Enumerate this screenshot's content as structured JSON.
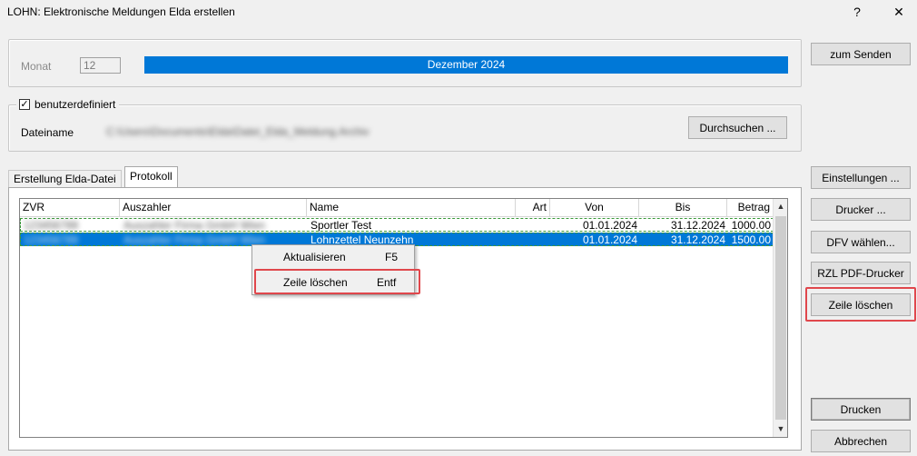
{
  "window": {
    "title": "LOHN: Elektronische Meldungen Elda erstellen",
    "help": "?",
    "close": "✕"
  },
  "top": {
    "monat_label": "Monat",
    "monat_value": "12",
    "progress_label": "Dezember  2024"
  },
  "file": {
    "checkbox_mark": "✓",
    "checkbox_label": "benutzerdefiniert",
    "dateiname_label": "Dateiname",
    "dateiname_value": "C:\\Users\\Documents\\Elda\\Datei_Elda_Meldung.Archiv",
    "browse_button": "Durchsuchen ..."
  },
  "tabs": [
    {
      "label": "Erstellung Elda-Datei",
      "active": false
    },
    {
      "label": "Protokoll",
      "active": true
    }
  ],
  "table": {
    "columns": [
      "ZVR",
      "Auszahler",
      "Name",
      "Art",
      "Von",
      "Bis",
      "Betrag"
    ],
    "rows": [
      {
        "zvr": "123456789",
        "auszahler": "Auszahler Firma GmbH Wien",
        "name": "Sportler Test",
        "art": "",
        "von": "01.01.2024",
        "bis": "31.12.2024",
        "betrag": "1000.00"
      },
      {
        "zvr": "123456789",
        "auszahler": "Auszahler Firma GmbH Wien",
        "name": "Lohnzettel Neunzehn",
        "art": "",
        "von": "01.01.2024",
        "bis": "31.12.2024",
        "betrag": "1500.00"
      }
    ]
  },
  "context_menu": [
    {
      "label": "Aktualisieren",
      "shortcut": "F5"
    },
    {
      "label": "Zeile löschen",
      "shortcut": "Entf"
    }
  ],
  "side_buttons": {
    "zum_senden": "zum Senden",
    "einstellungen": "Einstellungen ...",
    "drucker": "Drucker ...",
    "dfv": "DFV wählen...",
    "rzl_pdf": "RZL PDF-Drucker",
    "zeile_loeschen": "Zeile löschen",
    "drucken": "Drucken",
    "abbrechen": "Abbrechen"
  },
  "scrollbar": {
    "up": "▲",
    "down": "▼"
  },
  "colors": {
    "accent": "#0078d7",
    "highlight": "#e0474c"
  }
}
